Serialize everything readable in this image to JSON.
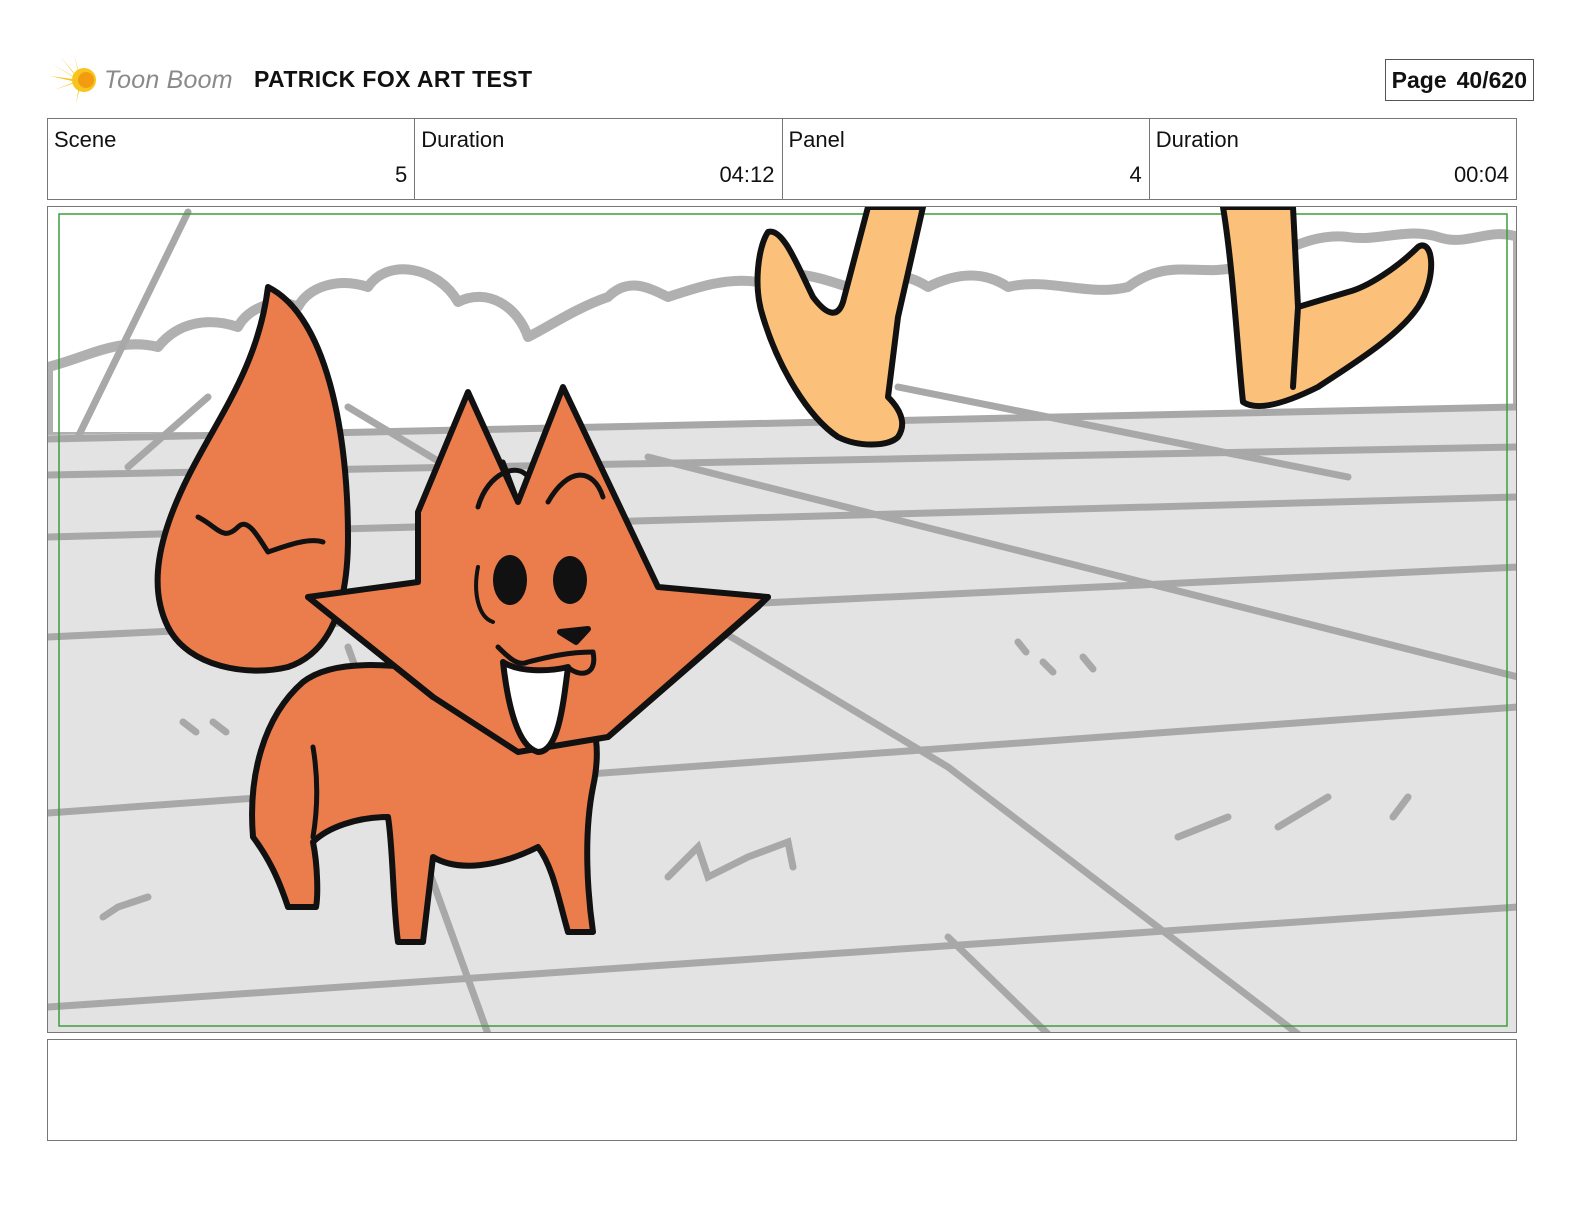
{
  "header": {
    "logo_text": "Toon Boom",
    "logo_icon": "starburst-logo-icon",
    "project_title": "PATRICK FOX ART TEST",
    "page_label": "Page",
    "page_number": "40/620"
  },
  "info": {
    "scene_label": "Scene",
    "scene_value": "5",
    "scene_duration_label": "Duration",
    "scene_duration_value": "04:12",
    "panel_label": "Panel",
    "panel_value": "4",
    "panel_duration_label": "Duration",
    "panel_duration_value": "00:04"
  },
  "colors": {
    "fox_orange": "#EB7C4B",
    "skin_tan": "#FBC17B",
    "ground_gray": "#E3E3E3",
    "sketch_gray": "#A8A8A8",
    "safe_frame_green": "#3E9E3E",
    "logo_yellow": "#F7C51E"
  },
  "notes": {
    "text": ""
  }
}
